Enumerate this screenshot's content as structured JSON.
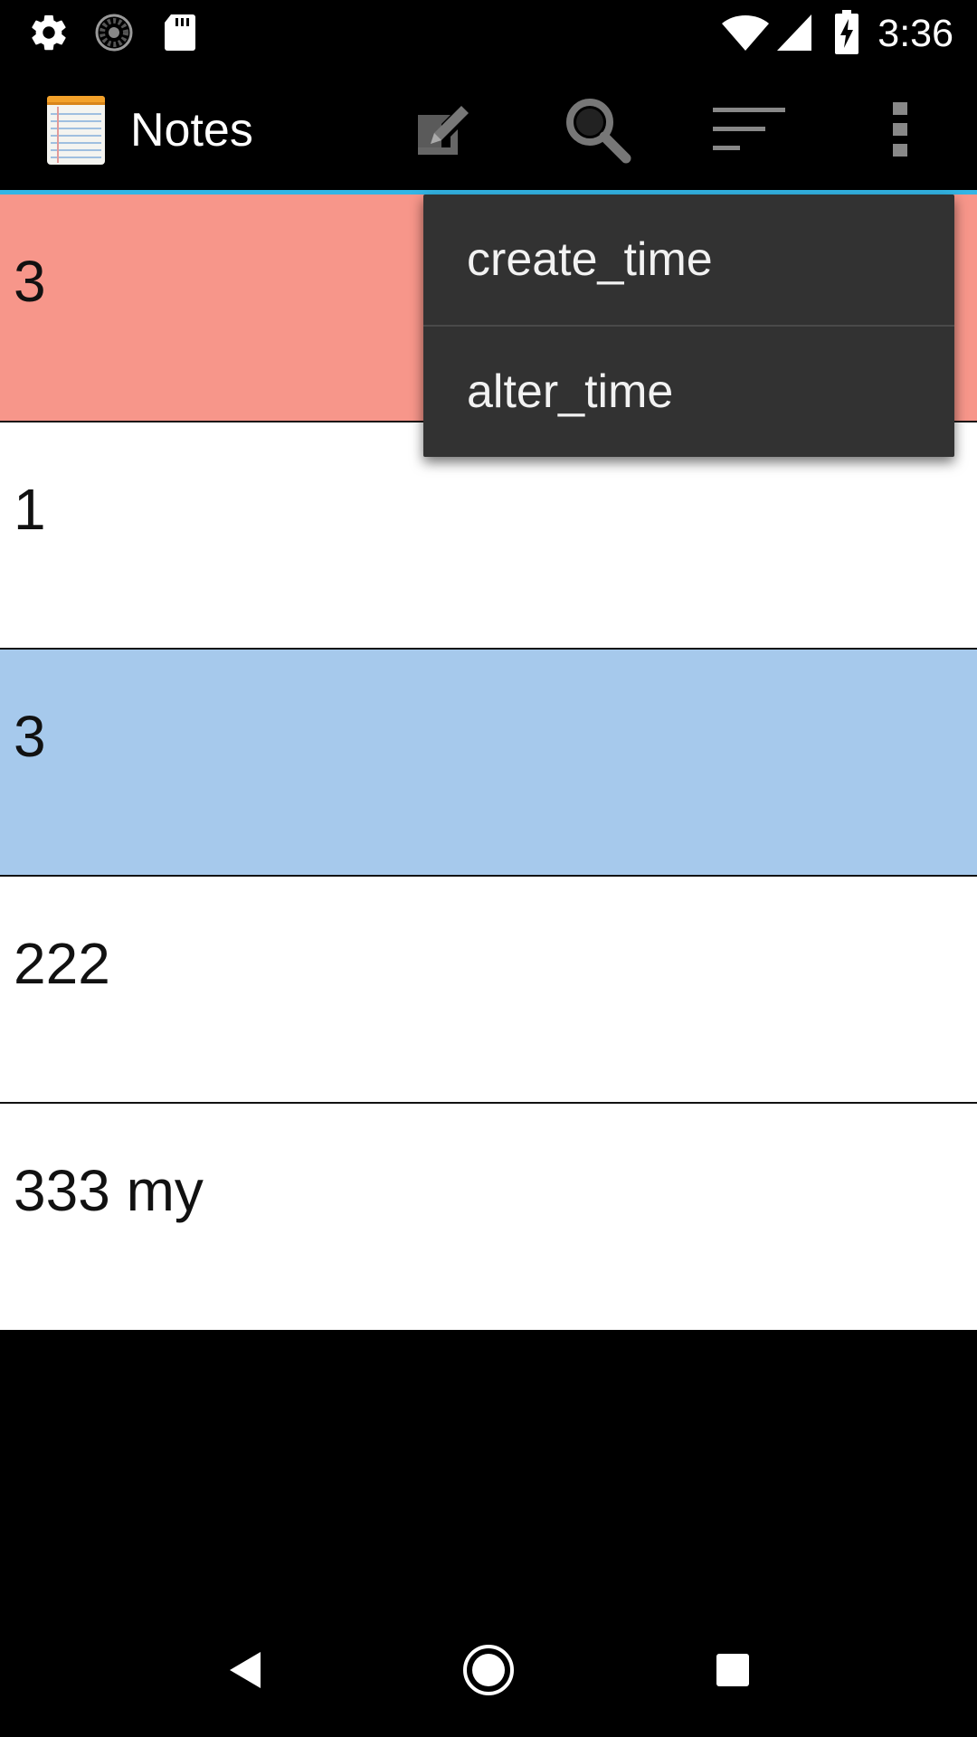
{
  "status_bar": {
    "time": "3:36",
    "left_icons": [
      "gear-icon",
      "loading-icon",
      "sd-card-icon"
    ],
    "right_icons": [
      "wifi-icon",
      "signal-icon",
      "battery-charging-icon"
    ]
  },
  "action_bar": {
    "title": "Notes",
    "icon": "notepad-icon",
    "actions": [
      "new-note-icon",
      "search-icon",
      "sort-icon",
      "overflow-menu-icon"
    ],
    "underline_color": "#33b5e5"
  },
  "notes": [
    {
      "title": "3",
      "color": "#f7968a"
    },
    {
      "title": "1",
      "color": "#ffffff"
    },
    {
      "title": "3",
      "color": "#a6c9ec"
    },
    {
      "title": "222",
      "color": "#ffffff"
    },
    {
      "title": "333 my",
      "color": "#ffffff"
    }
  ],
  "sort_menu": {
    "items": [
      "create_time",
      "alter_time"
    ]
  },
  "nav_bar": {
    "buttons": [
      "back-icon",
      "home-icon",
      "recents-icon"
    ]
  }
}
